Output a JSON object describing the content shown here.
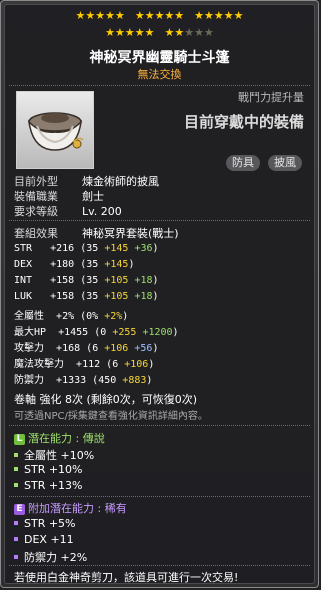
{
  "stars": {
    "row1_filled": 15,
    "row2_filled": 7,
    "row2_total": 10
  },
  "item": {
    "name": "神秘冥界幽靈騎士斗篷",
    "trade_status": "無法交換"
  },
  "header": {
    "power_label": "戰鬥力提升量",
    "equipped_label": "目前穿戴中的裝備",
    "tags": [
      "防具",
      "披風"
    ]
  },
  "info": [
    {
      "label": "目前外型",
      "value": "煉金術師的披風"
    },
    {
      "label": "裝備職業",
      "value": "劍士"
    },
    {
      "label": "要求等級",
      "value": "Lv. 200"
    }
  ],
  "set": {
    "label": "套組效果",
    "value": "神秘冥界套裝(戰士)"
  },
  "stats": {
    "str": {
      "label": "STR",
      "total": "+216",
      "base": "35",
      "bonus": "+145",
      "extra": "+36"
    },
    "dex": {
      "label": "DEX",
      "total": "+180",
      "base": "35",
      "bonus": "+145"
    },
    "int": {
      "label": "INT",
      "total": "+158",
      "base": "35",
      "bonus": "+105",
      "extra": "+18"
    },
    "luk": {
      "label": "LUK",
      "total": "+158",
      "base": "35",
      "bonus": "+105",
      "extra": "+18"
    },
    "all": {
      "label": "全屬性",
      "total": "+2%",
      "base": "0%",
      "bonus": "+2%"
    },
    "hp": {
      "label": "最大HP",
      "total": "+1455",
      "base": "0",
      "bonus": "+255",
      "extra": "+1200"
    },
    "atk": {
      "label": "攻擊力",
      "total": "+168",
      "base": "6",
      "bonus": "+106",
      "extra": "+56"
    },
    "matk": {
      "label": "魔法攻擊力",
      "total": "+112",
      "base": "6",
      "bonus": "+106"
    },
    "def": {
      "label": "防禦力",
      "total": "+1333",
      "base": "450",
      "bonus": "+883"
    }
  },
  "scroll": {
    "label": "卷軸 強化",
    "value": "8次",
    "detail": "(剩餘0次，可恢復0次)"
  },
  "enhance_note": "可透過NPC/採集鍵查看強化資訊詳細內容。",
  "potential": {
    "badge": "L",
    "title": "潛在能力 : 傳說",
    "lines": [
      "全屬性 +10%",
      "STR +10%",
      "STR +13%"
    ]
  },
  "additional": {
    "badge": "E",
    "title": "附加潛在能力 : 稀有",
    "lines": [
      "STR +5%",
      "DEX +11",
      "防禦力 +2%"
    ]
  },
  "footer": "若使用白金神奇剪刀，該道具可進行一次交易!",
  "colors": {
    "legendary": "#9ee06b",
    "epic": "#b77cff",
    "star": "#ffcc00",
    "bonus": "#f5d538",
    "green": "#9ee06b",
    "blue": "#9cc0ff"
  }
}
